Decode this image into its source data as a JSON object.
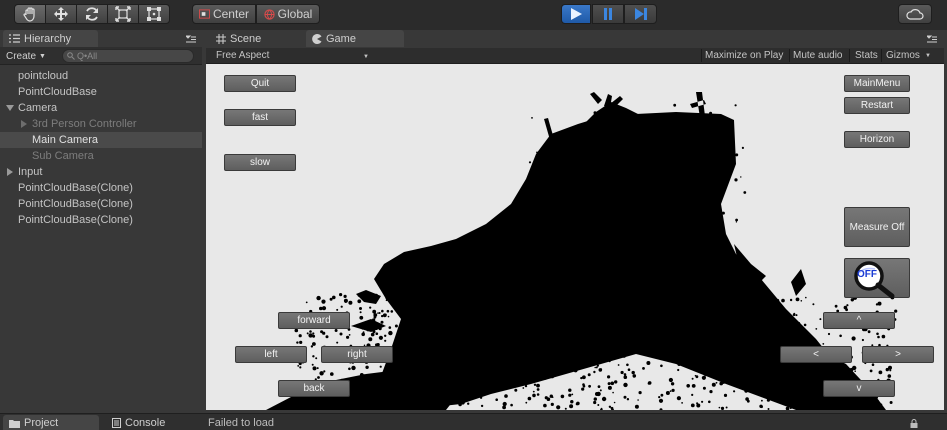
{
  "toolbar": {
    "tools": [
      "hand-tool",
      "move-tool",
      "rotate-tool",
      "scale-tool",
      "rect-tool"
    ],
    "pivot_label": "Center",
    "space_label": "Global",
    "play_controls": [
      "play",
      "pause",
      "step"
    ],
    "accent": "#2f6fc0"
  },
  "hierarchy": {
    "tab_label": "Hierarchy",
    "create_label": "Create",
    "search_placeholder": "Q•All",
    "items": [
      {
        "label": "pointcloud",
        "indent": 0,
        "arrow": "none",
        "state": "normal"
      },
      {
        "label": "PointCloudBase",
        "indent": 0,
        "arrow": "none",
        "state": "normal"
      },
      {
        "label": "Camera",
        "indent": 0,
        "arrow": "expanded",
        "state": "normal"
      },
      {
        "label": "3rd Person Controller",
        "indent": 1,
        "arrow": "collapsed",
        "state": "dim"
      },
      {
        "label": "Main Camera",
        "indent": 1,
        "arrow": "none",
        "state": "selected"
      },
      {
        "label": "Sub Camera",
        "indent": 1,
        "arrow": "none",
        "state": "dim"
      },
      {
        "label": "Input",
        "indent": 0,
        "arrow": "collapsed",
        "state": "normal"
      },
      {
        "label": "PointCloudBase(Clone)",
        "indent": 0,
        "arrow": "none",
        "state": "normal"
      },
      {
        "label": "PointCloudBase(Clone)",
        "indent": 0,
        "arrow": "none",
        "state": "normal"
      },
      {
        "label": "PointCloudBase(Clone)",
        "indent": 0,
        "arrow": "none",
        "state": "normal"
      }
    ]
  },
  "view": {
    "tabs": [
      {
        "label": "Scene",
        "icon": "grid-icon"
      },
      {
        "label": "Game",
        "icon": "pacman-icon"
      }
    ],
    "aspect_label": "Free Aspect",
    "maximize_label": "Maximize on Play",
    "mute_label": "Mute audio",
    "stats_label": "Stats",
    "gizmos_label": "Gizmos"
  },
  "game": {
    "left_buttons": {
      "quit": "Quit",
      "fast": "fast",
      "slow": "slow"
    },
    "right_buttons": {
      "main_menu": "MainMenu",
      "restart": "Restart",
      "horizon": "Horizon",
      "measure": "Measure Off",
      "magnifier_label": "OFF"
    },
    "nav": {
      "forward": "forward",
      "left": "left",
      "right": "right",
      "back": "back",
      "up": "^",
      "prev": "<",
      "next": ">",
      "down": "v"
    }
  },
  "bottom": {
    "project_tab": "Project",
    "console_tab": "Console",
    "status": "Failed to load"
  }
}
